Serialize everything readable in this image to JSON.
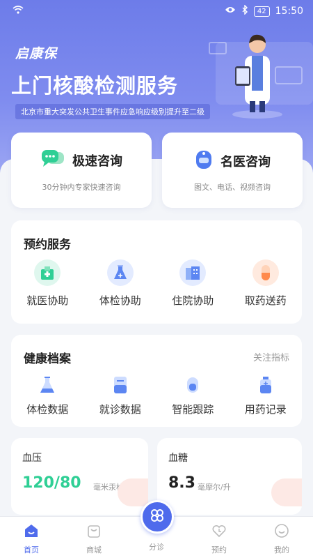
{
  "status_bar": {
    "battery": "42",
    "time": "15:50"
  },
  "hero": {
    "brand": "启康保",
    "headline": "上门核酸检测服务",
    "notice": "北京市重大突发公共卫生事件应急响应级别提升至二级"
  },
  "consult": [
    {
      "title": "极速咨询",
      "desc": "30分钟内专家快速咨询",
      "icon": "chat-bubbles-icon"
    },
    {
      "title": "名医咨询",
      "desc": "图文、电话、视频咨询",
      "icon": "doctor-avatar-icon"
    }
  ],
  "appointment": {
    "title": "预约服务",
    "items": [
      {
        "label": "就医协助",
        "icon": "hospital-icon"
      },
      {
        "label": "体检协助",
        "icon": "flask-icon"
      },
      {
        "label": "住院协助",
        "icon": "building-icon"
      },
      {
        "label": "取药送药",
        "icon": "capsule-icon"
      }
    ]
  },
  "health_record": {
    "title": "健康档案",
    "link": "关注指标",
    "items": [
      {
        "label": "体检数据",
        "icon": "flask-icon"
      },
      {
        "label": "就诊数据",
        "icon": "document-icon"
      },
      {
        "label": "智能跟踪",
        "icon": "tracker-icon"
      },
      {
        "label": "用药记录",
        "icon": "medicine-bottle-icon"
      }
    ]
  },
  "metrics": [
    {
      "title": "血压",
      "value": "120/80",
      "unit": "毫米汞柱",
      "color": "#2fcf95"
    },
    {
      "title": "血糖",
      "value": "8.3",
      "unit": "毫摩尔/升",
      "color": "#222222"
    }
  ],
  "tabbar": {
    "items": [
      {
        "label": "首页",
        "icon": "home-smile-icon",
        "active": true
      },
      {
        "label": "商城",
        "icon": "shopping-bag-icon",
        "active": false
      },
      {
        "label": "分诊",
        "icon": "clover-icon",
        "active": false
      },
      {
        "label": "预约",
        "icon": "heart-clock-icon",
        "active": false
      },
      {
        "label": "我的",
        "icon": "smile-face-icon",
        "active": false
      }
    ]
  },
  "colors": {
    "primary": "#4f6bec",
    "hero": "#7382ec",
    "accent_green": "#2fcf95"
  }
}
